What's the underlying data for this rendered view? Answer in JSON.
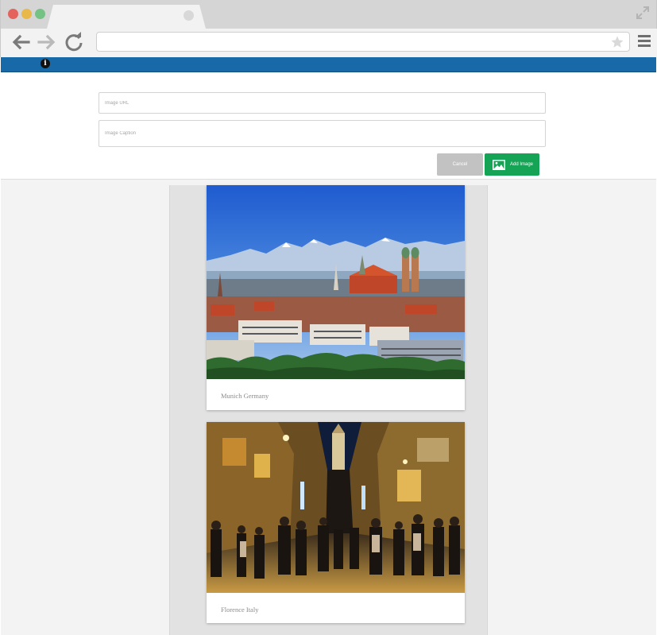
{
  "browser": {
    "tab_title": "",
    "address": "",
    "icons": [
      "back-arrow-icon",
      "forward-arrow-icon",
      "reload-icon",
      "star-icon",
      "menu-icon",
      "expand-icon"
    ]
  },
  "form": {
    "image_url_placeholder": "Image URL",
    "image_caption_placeholder": "Image Caption",
    "cancel_label": "Cancel",
    "add_label": "Add Image"
  },
  "feed": {
    "cards": [
      {
        "caption": "Munich Germany",
        "photo": "munich-skyline-photo"
      },
      {
        "caption": "Florence Italy",
        "photo": "florence-street-photo"
      }
    ]
  },
  "colors": {
    "appbar": "#176aa7",
    "add_button": "#15a455",
    "cancel_button": "#c2c2c2"
  }
}
